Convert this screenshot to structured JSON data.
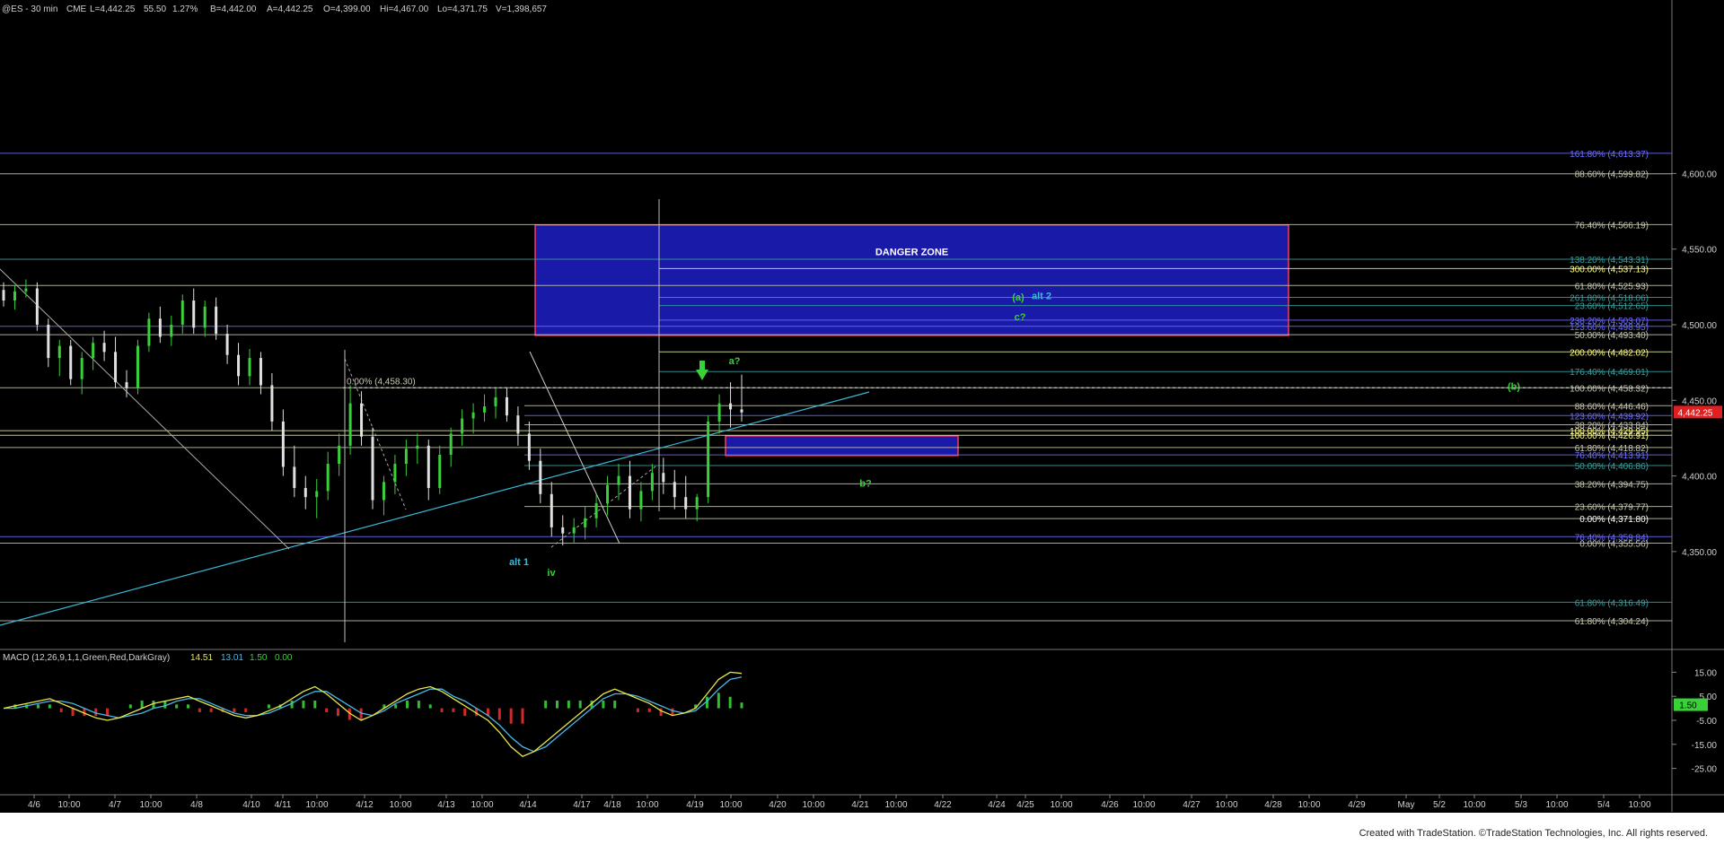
{
  "header": {
    "symbol": "@ES - 30 min",
    "exchange": "CME",
    "last": "L=4,442.25",
    "change": "55.50",
    "change_pct": "1.27%",
    "bid": "B=4,442.00",
    "ask": "A=4,442.25",
    "open": "O=4,399.00",
    "high": "Hi=4,467.00",
    "low": "Lo=4,371.75",
    "volume": "V=1,398,657"
  },
  "chart_data": {
    "type": "candlestick",
    "price_axis": {
      "range": [
        4290,
        4710
      ],
      "ticks": [
        "4,600.00",
        "4,550.00",
        "4,500.00",
        "4,450.00",
        "4,400.00",
        "4,350.00"
      ],
      "last_price_label": "4,442.25"
    },
    "x_axis": {
      "labels": [
        "4/6",
        "10:00",
        "4/7",
        "10:00",
        "4/8",
        "4/10",
        "4/11",
        "10:00",
        "4/12",
        "10:00",
        "4/13",
        "10:00",
        "4/14",
        "4/17",
        "4/18",
        "10:00",
        "4/19",
        "10:00",
        "4/20",
        "10:00",
        "4/21",
        "10:00",
        "4/22",
        "4/24",
        "4/25",
        "10:00",
        "4/26",
        "10:00",
        "4/27",
        "10:00",
        "4/28",
        "10:00",
        "4/29",
        "May",
        "5/2",
        "10:00",
        "5/3",
        "10:00",
        "5/4",
        "10:00"
      ]
    },
    "fib_levels": [
      {
        "label": "161.80% (4,613.37)",
        "price": 4613.37,
        "color": "#6f6fff",
        "text_color": "#6f6fff"
      },
      {
        "label": "88.60% (4,599.82)",
        "price": 4599.82,
        "color": "#c8c8b4",
        "text_color": "#c8c8b4"
      },
      {
        "label": "76.40% (4,566.19)",
        "price": 4566.19,
        "color": "#c8c8b4",
        "text_color": "#c8c8b4"
      },
      {
        "label": "138.20% (4,543.31)",
        "price": 4543.31,
        "color": "#3aa0a0",
        "text_color": "#3aa0a0"
      },
      {
        "label": "300.00% (4,537.13)",
        "price": 4537.13,
        "color": "#e8e8a0",
        "text_color": "#ffff8a"
      },
      {
        "label": "61.80% (4,525.93)",
        "price": 4525.93,
        "color": "#c8c8b4",
        "text_color": "#c8c8b4"
      },
      {
        "label": "261.80% (4,518.06)",
        "price": 4518.06,
        "color": "#3aa0a0",
        "text_color": "#3aa0a0"
      },
      {
        "label": "23.60% (4,512.65)",
        "price": 4512.65,
        "color": "#3aa0a0",
        "text_color": "#3aa0a0"
      },
      {
        "label": "238.20% (4,503.07)",
        "price": 4503.07,
        "color": "#6f6fff",
        "text_color": "#6f6fff"
      },
      {
        "label": "123.60% (4,498.95)",
        "price": 4498.95,
        "color": "#6f6fff",
        "text_color": "#6f6fff"
      },
      {
        "label": "50.00% (4,493.40)",
        "price": 4493.4,
        "color": "#c8c8b4",
        "text_color": "#c8c8b4"
      },
      {
        "label": "200.00% (4,482.02)",
        "price": 4482.02,
        "color": "#e8e8a0",
        "text_color": "#ffff8a"
      },
      {
        "label": "176.40% (4,469.01)",
        "price": 4469.01,
        "color": "#3aa0a0",
        "text_color": "#3aa0a0"
      },
      {
        "label": "100.00% (4,458.32)",
        "price": 4458.32,
        "color": "#c8c8b4",
        "text_color": "#c8c8b4"
      },
      {
        "label": "88.60% (4,446.46)",
        "price": 4446.46,
        "color": "#c8c8b4",
        "text_color": "#c8c8b4"
      },
      {
        "label": "123.60% (4,439.92)",
        "price": 4439.92,
        "color": "#6f6fff",
        "text_color": "#6f6fff"
      },
      {
        "label": "38.20% (4,433.84)",
        "price": 4433.84,
        "color": "#c8c8b4",
        "text_color": "#c8c8b4"
      },
      {
        "label": "100.00% (4,429.95)",
        "price": 4429.95,
        "color": "#e8e8a0",
        "text_color": "#ffff8a"
      },
      {
        "label": "100.00% (4,426.91)",
        "price": 4426.91,
        "color": "#e8e8a0",
        "text_color": "#ffff8a"
      },
      {
        "label": "61.80% (4,418.82)",
        "price": 4418.82,
        "color": "#c8c8b4",
        "text_color": "#c8c8b4"
      },
      {
        "label": "76.40% (4,413.91)",
        "price": 4413.91,
        "color": "#6f6fff",
        "text_color": "#6f6fff"
      },
      {
        "label": "50.00% (4,406.86)",
        "price": 4406.86,
        "color": "#3aa0a0",
        "text_color": "#3aa0a0"
      },
      {
        "label": "38.20% (4,394.75)",
        "price": 4394.75,
        "color": "#c8c8b4",
        "text_color": "#c8c8b4"
      },
      {
        "label": "23.60% (4,379.77)",
        "price": 4379.77,
        "color": "#c8c8b4",
        "text_color": "#c8c8b4"
      },
      {
        "label": "0.00% (4,371.80)",
        "price": 4371.8,
        "color": "#c8c8b4",
        "text_color": "#ffffff"
      },
      {
        "label": "76.40% (4,359.84)",
        "price": 4359.84,
        "color": "#6f6fff",
        "text_color": "#6f6fff"
      },
      {
        "label": "0.00% (4,355.56)",
        "price": 4355.56,
        "color": "#c8c8b4",
        "text_color": "#c8c8b4"
      },
      {
        "label": "61.80% (4,316.49)",
        "price": 4316.49,
        "color": "#3aa0a0",
        "text_color": "#3aa0a0"
      },
      {
        "label": "61.80% (4,304.24)",
        "price": 4304.24,
        "color": "#c8c8b4",
        "text_color": "#c8c8b4"
      }
    ],
    "inline_level_label": {
      "label": "0.00% (4,458.30)",
      "price": 4458.3
    },
    "zones": [
      {
        "label": "DANGER ZONE",
        "price_top": 4566,
        "price_bottom": 4493,
        "fill": "#1a1aa8",
        "border": "#ff3b5c"
      },
      {
        "label": "",
        "price_top": 4426.5,
        "price_bottom": 4413.5,
        "fill": "#1a1aa8",
        "border": "#ff3b5c"
      }
    ],
    "wave_labels": [
      {
        "text": "(a)",
        "color": "#3ad03a",
        "price": 4516
      },
      {
        "text": "alt 2",
        "color": "#3ab8d8",
        "price": 4517
      },
      {
        "text": "c?",
        "color": "#3ad03a",
        "price": 4503
      },
      {
        "text": "a?",
        "color": "#3ad03a",
        "price": 4474
      },
      {
        "text": "(b)",
        "color": "#3ad03a",
        "price": 4457
      },
      {
        "text": "b?",
        "color": "#3ad03a",
        "price": 4393
      },
      {
        "text": "alt 1",
        "color": "#3ab8d8",
        "price": 4341
      },
      {
        "text": "iv",
        "color": "#3ad03a",
        "price": 4334
      }
    ],
    "candles_ohlc_approx": [
      [
        4523,
        4528,
        4512,
        4516
      ],
      [
        4516,
        4526,
        4510,
        4522
      ],
      [
        4522,
        4530,
        4518,
        4524
      ],
      [
        4524,
        4528,
        4496,
        4500
      ],
      [
        4500,
        4504,
        4472,
        4478
      ],
      [
        4478,
        4490,
        4466,
        4486
      ],
      [
        4486,
        4490,
        4460,
        4464
      ],
      [
        4464,
        4482,
        4454,
        4478
      ],
      [
        4478,
        4492,
        4470,
        4488
      ],
      [
        4488,
        4496,
        4476,
        4482
      ],
      [
        4482,
        4492,
        4458,
        4462
      ],
      [
        4462,
        4470,
        4452,
        4458
      ],
      [
        4458,
        4490,
        4454,
        4486
      ],
      [
        4486,
        4508,
        4482,
        4504
      ],
      [
        4504,
        4512,
        4488,
        4492
      ],
      [
        4492,
        4506,
        4486,
        4500
      ],
      [
        4500,
        4520,
        4494,
        4516
      ],
      [
        4516,
        4524,
        4494,
        4498
      ],
      [
        4498,
        4516,
        4492,
        4512
      ],
      [
        4512,
        4518,
        4490,
        4494
      ],
      [
        4494,
        4500,
        4474,
        4480
      ],
      [
        4480,
        4488,
        4460,
        4466
      ],
      [
        4466,
        4484,
        4460,
        4478
      ],
      [
        4478,
        4482,
        4454,
        4460
      ],
      [
        4460,
        4468,
        4430,
        4436
      ],
      [
        4436,
        4444,
        4400,
        4406
      ],
      [
        4406,
        4420,
        4386,
        4392
      ],
      [
        4392,
        4400,
        4378,
        4386
      ],
      [
        4386,
        4398,
        4372,
        4390
      ],
      [
        4390,
        4416,
        4384,
        4408
      ],
      [
        4408,
        4428,
        4400,
        4420
      ],
      [
        4420,
        4460,
        4414,
        4448
      ],
      [
        4448,
        4456,
        4420,
        4426
      ],
      [
        4426,
        4432,
        4378,
        4384
      ],
      [
        4384,
        4400,
        4374,
        4396
      ],
      [
        4396,
        4414,
        4388,
        4408
      ],
      [
        4408,
        4424,
        4400,
        4418
      ],
      [
        4418,
        4428,
        4408,
        4420
      ],
      [
        4420,
        4424,
        4384,
        4392
      ],
      [
        4392,
        4420,
        4388,
        4414
      ],
      [
        4414,
        4432,
        4406,
        4428
      ],
      [
        4428,
        4444,
        4420,
        4438
      ],
      [
        4438,
        4448,
        4428,
        4442
      ],
      [
        4442,
        4454,
        4436,
        4446
      ],
      [
        4446,
        4458,
        4438,
        4452
      ],
      [
        4452,
        4458,
        4436,
        4440
      ],
      [
        4440,
        4446,
        4420,
        4428
      ],
      [
        4428,
        4436,
        4404,
        4410
      ],
      [
        4410,
        4418,
        4382,
        4388
      ],
      [
        4388,
        4396,
        4360,
        4366
      ],
      [
        4366,
        4374,
        4354,
        4362
      ],
      [
        4362,
        4372,
        4356,
        4366
      ],
      [
        4366,
        4380,
        4358,
        4372
      ],
      [
        4372,
        4388,
        4366,
        4382
      ],
      [
        4382,
        4400,
        4374,
        4394
      ],
      [
        4394,
        4408,
        4384,
        4400
      ],
      [
        4400,
        4410,
        4372,
        4378
      ],
      [
        4378,
        4396,
        4370,
        4390
      ],
      [
        4390,
        4408,
        4384,
        4402
      ],
      [
        4402,
        4412,
        4388,
        4396
      ],
      [
        4396,
        4404,
        4378,
        4386
      ],
      [
        4386,
        4400,
        4372,
        4378
      ],
      [
        4378,
        4388,
        4370,
        4386
      ],
      [
        4386,
        4440,
        4382,
        4436
      ],
      [
        4436,
        4454,
        4428,
        4448
      ],
      [
        4448,
        4462,
        4432,
        4444
      ],
      [
        4444,
        4467,
        4436,
        4442
      ]
    ],
    "indicator": {
      "name": "MACD (12,26,9,1,1,Green,Red,DarkGray)",
      "values": [
        "14.51",
        "13.01",
        "1.50",
        "0.00"
      ],
      "value_colors": [
        "#e8e84a",
        "#4ab8e8",
        "#3ad03a",
        "#3ad03a"
      ],
      "axis_ticks": [
        "15.00",
        "5.00",
        "-5.00",
        "-15.00",
        "-25.00"
      ],
      "range": [
        -30,
        20
      ],
      "last_label": "1.50",
      "macd_line": [
        0,
        1,
        2,
        3,
        4,
        2,
        0,
        -2,
        -4,
        -5,
        -4,
        -2,
        0,
        2,
        3,
        4,
        5,
        3,
        1,
        -1,
        -3,
        -4,
        -3,
        -1,
        1,
        4,
        7,
        9,
        6,
        2,
        -2,
        -5,
        -3,
        0,
        3,
        6,
        8,
        9,
        7,
        4,
        1,
        -2,
        -5,
        -10,
        -16,
        -20,
        -18,
        -14,
        -10,
        -6,
        -2,
        2,
        6,
        8,
        6,
        4,
        2,
        -1,
        -3,
        -2,
        0,
        6,
        12,
        15,
        14.5
      ],
      "signal_line": [
        0,
        0,
        1,
        2,
        3,
        3,
        2,
        0,
        -2,
        -3,
        -4,
        -3,
        -2,
        0,
        1,
        3,
        4,
        4,
        2,
        0,
        -2,
        -3,
        -3,
        -2,
        0,
        2,
        5,
        7,
        7,
        4,
        1,
        -2,
        -3,
        -1,
        2,
        4,
        6,
        8,
        8,
        5,
        3,
        0,
        -3,
        -7,
        -12,
        -16,
        -18,
        -16,
        -12,
        -8,
        -4,
        0,
        4,
        6,
        6,
        5,
        3,
        1,
        -1,
        -2,
        -1,
        3,
        8,
        12,
        13
      ]
    }
  },
  "footer": {
    "credit": "Created with TradeStation. ©TradeStation Technologies, Inc. All rights reserved."
  }
}
